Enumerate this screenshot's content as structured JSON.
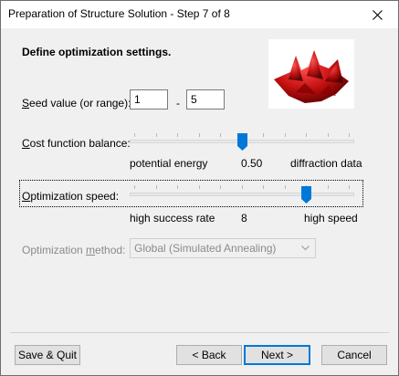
{
  "window": {
    "title": "Preparation of Structure Solution - Step 7 of 8",
    "close_icon": "close-icon"
  },
  "main": {
    "heading": "Define optimization settings.",
    "seed": {
      "label_underlined": "S",
      "label_rest": "eed value (or range):",
      "from_value": "1",
      "separator": "-",
      "to_value": "5"
    },
    "cost_balance": {
      "label_underlined": "C",
      "label_rest": "ost function balance:",
      "left_caption": "potential energy",
      "value": "0.50",
      "right_caption": "diffraction data",
      "slider_fraction": 0.5
    },
    "speed": {
      "label_underlined": "O",
      "label_rest": "ptimization speed:",
      "left_caption": "high success rate",
      "value": "8",
      "right_caption": "high speed",
      "slider_fraction": 0.8
    },
    "method": {
      "label_before": "Optimization ",
      "label_underlined": "m",
      "label_after": "ethod:",
      "selected": "Global (Simulated Annealing)"
    }
  },
  "buttons": {
    "save_quit": "Save & Quit",
    "back": "< Back",
    "next": "Next >",
    "cancel": "Cancel"
  },
  "colors": {
    "slider_thumb": "#0078d7",
    "default_button_border": "#0078d7",
    "surface_red": "#c41010"
  }
}
